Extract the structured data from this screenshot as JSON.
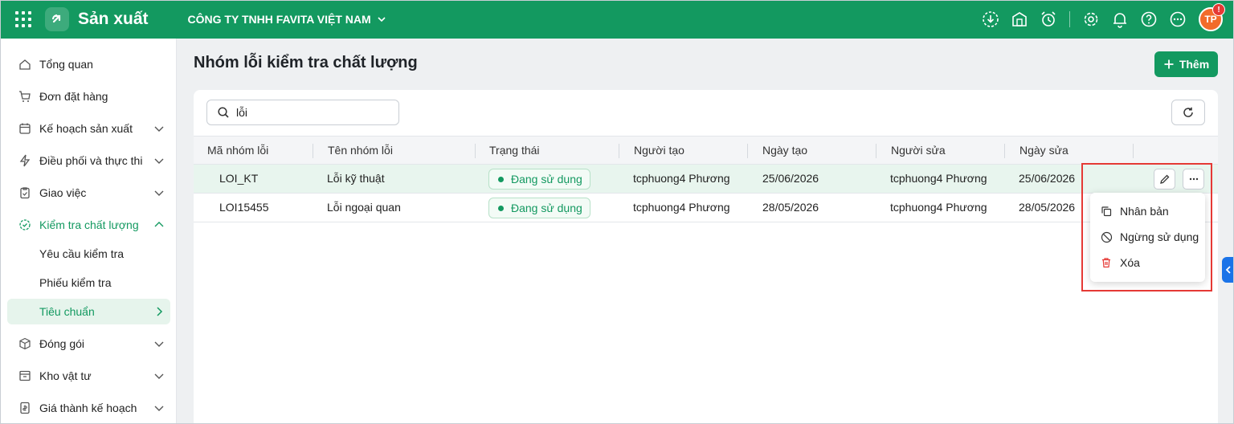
{
  "app": {
    "title": "Sản xuất",
    "company": "CÔNG TY TNHH FAVITA VIỆT NAM",
    "avatar_initials": "TP",
    "avatar_badge": "!"
  },
  "sidebar": {
    "items": [
      {
        "label": "Tổng quan",
        "icon": "home-icon"
      },
      {
        "label": "Đơn đặt hàng",
        "icon": "cart-icon"
      },
      {
        "label": "Kế hoạch sản xuất",
        "icon": "calendar-icon"
      },
      {
        "label": "Điều phối và thực thi",
        "icon": "bolt-icon"
      },
      {
        "label": "Giao việc",
        "icon": "clipboard-icon"
      },
      {
        "label": "Kiểm tra chất lượng",
        "icon": "check-circle-icon"
      },
      {
        "label": "Yêu cầu kiểm tra"
      },
      {
        "label": "Phiếu kiểm tra"
      },
      {
        "label": "Tiêu chuẩn"
      },
      {
        "label": "Đóng gói",
        "icon": "box-icon"
      },
      {
        "label": "Kho vật tư",
        "icon": "warehouse-icon"
      },
      {
        "label": "Giá thành kế hoạch",
        "icon": "price-icon"
      }
    ]
  },
  "main": {
    "title": "Nhóm lỗi kiểm tra chất lượng",
    "add_label": "Thêm",
    "search": {
      "value": "lỗi",
      "placeholder": ""
    },
    "columns": [
      "Mã nhóm lỗi",
      "Tên nhóm lỗi",
      "Trạng thái",
      "Người tạo",
      "Ngày tạo",
      "Người sửa",
      "Ngày sửa"
    ],
    "rows": [
      {
        "code": "LOI_KT",
        "name": "Lỗi kỹ thuật",
        "status": "Đang sử dụng",
        "creator": "tcphuong4 Phương",
        "created": "25/06/2026",
        "editor": "tcphuong4 Phương",
        "edited": "25/06/2026"
      },
      {
        "code": "LOI15455",
        "name": "Lỗi ngoại quan",
        "status": "Đang sử dụng",
        "creator": "tcphuong4 Phương",
        "created": "28/05/2026",
        "editor": "tcphuong4 Phương",
        "edited": "28/05/2026"
      }
    ]
  },
  "context_menu": {
    "items": [
      {
        "label": "Nhân bản",
        "icon": "copy-icon"
      },
      {
        "label": "Ngừng sử dụng",
        "icon": "ban-icon"
      },
      {
        "label": "Xóa",
        "icon": "trash-icon"
      }
    ]
  },
  "colors": {
    "brand": "#139960",
    "highlight_border": "#e53935",
    "danger": "#e53935"
  }
}
